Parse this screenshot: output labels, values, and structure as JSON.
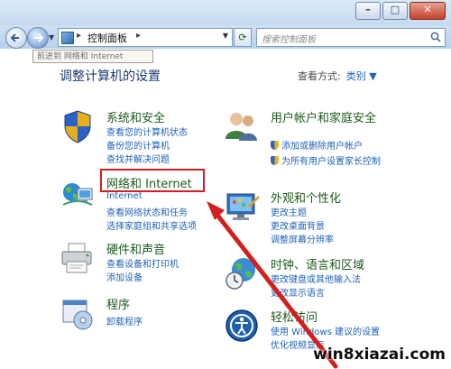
{
  "window": {
    "minimize_glyph": "–",
    "maximize_glyph": "□",
    "close_glyph": "✕"
  },
  "navbar": {
    "breadcrumb": "控制面板",
    "sep": "▸",
    "search_placeholder": "搜索控制面板",
    "tooltip": "前进到 网络和 Internet"
  },
  "header": {
    "title": "调整计算机的设置",
    "viewby_label": "查看方式:",
    "viewby_value": "类别 ▼"
  },
  "categories": {
    "system": {
      "title": "系统和安全",
      "links": [
        "查看您的计算机状态",
        "备份您的计算机",
        "查找并解决问题"
      ]
    },
    "network": {
      "title": "网络和 Internet",
      "links": [
        "查看网络状态和任务",
        "选择家庭组和共享选项"
      ],
      "partial_link": "Internet"
    },
    "hardware": {
      "title": "硬件和声音",
      "links": [
        "查看设备和打印机",
        "添加设备"
      ]
    },
    "programs": {
      "title": "程序",
      "links": [
        "卸载程序"
      ]
    },
    "accounts": {
      "title": "用户帐户和家庭安全",
      "links": [
        "添加或删除用户帐户",
        "为所有用户设置家长控制"
      ]
    },
    "appearance": {
      "title": "外观和个性化",
      "links": [
        "更改主题",
        "更改桌面背景",
        "调整屏幕分辨率"
      ]
    },
    "clock": {
      "title": "时钟、语言和区域",
      "links": [
        "更改键盘或其他输入法",
        "更改显示语言"
      ]
    },
    "ease": {
      "title": "轻松访问",
      "links": [
        "使用 Windows 建议的设置",
        "优化视频显示"
      ]
    }
  },
  "watermark": "win8xiazai.com",
  "colors": {
    "annotation_red": "#d41f1f",
    "link_blue": "#2262b8",
    "heading_green": "#1d5a1d"
  }
}
